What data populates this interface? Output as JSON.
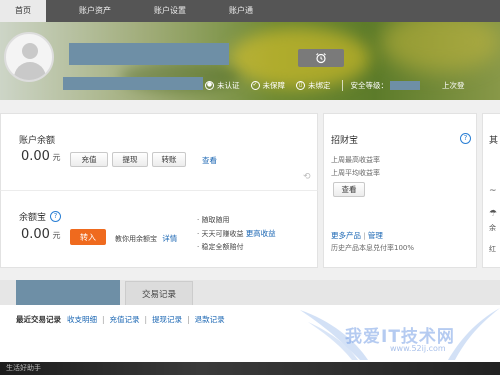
{
  "nav": {
    "items": [
      "首页",
      "账户资产",
      "账户设置",
      "账户通"
    ]
  },
  "header": {
    "status": {
      "unverified": "未认证",
      "unprotected": "未保障",
      "unbound": "未绑定",
      "security_level_label": "安全等级：",
      "last_login": "上次登"
    }
  },
  "balance": {
    "title": "账户余额",
    "amount": "0.00",
    "unit": "元",
    "buttons": [
      "充值",
      "提现",
      "转账"
    ],
    "view_link": "查看"
  },
  "yuebao": {
    "title": "余额宝",
    "amount": "0.00",
    "unit": "元",
    "transfer_button": "转入",
    "teach_text": "教你用余额宝",
    "detail_link": "详情",
    "features": [
      "随取随用",
      "天天可赚收益",
      "稳定全额赔付"
    ],
    "more_earnings_link": "更高收益"
  },
  "zhaocai": {
    "title": "招财宝",
    "rate1": "上周最高收益率",
    "rate2": "上周平均收益率",
    "view_button": "查看",
    "more_link": "更多产品",
    "manage_link": "管理",
    "history_text": "历史产品本息兑付率100%"
  },
  "right_panel": {
    "title_fragment": "其",
    "text1": "余",
    "text2": "红"
  },
  "tabs": {
    "records": "交易记录"
  },
  "subnav": {
    "current": "最近交易记录",
    "links": [
      "收支明细",
      "充值记录",
      "提现记录",
      "退款记录"
    ]
  },
  "footer": {
    "text": "生活好助手"
  },
  "watermark": {
    "text": "我爱IT技术网",
    "url": "www.52ij.com"
  },
  "colors": {
    "nav_bg": "#555555",
    "redacted": "#6e8fa6",
    "orange_button": "#ef6a1e",
    "link": "#1a66b3"
  }
}
